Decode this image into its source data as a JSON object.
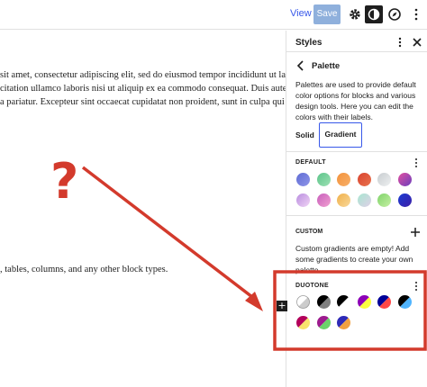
{
  "toolbar": {
    "view_label": "View",
    "save_label": "Save",
    "icons": [
      "gear-icon",
      "styles-icon",
      "compass-icon"
    ]
  },
  "canvas": {
    "para1_lines": [
      "sit amet, consectetur adipiscing elit, sed do eiusmod tempor incididunt ut labore et",
      "citation ullamco laboris nisi ut aliquip ex ea commodo consequat. Duis aute irure dolor",
      "a pariatur. Excepteur sint occaecat cupidatat non proident, sunt in culpa qui officia"
    ],
    "para2": ", tables, columns, and any other block types.",
    "annotation_mark": "?"
  },
  "sidebar": {
    "title": "Styles",
    "palette_title": "Palette",
    "palette_desc": "Palettes are used to provide default color options for blocks and various design tools. Here you can edit the colors with their labels.",
    "tabs": {
      "solid": "Solid",
      "gradient": "Gradient"
    },
    "default_label": "DEFAULT",
    "custom_label": "CUSTOM",
    "custom_desc": "Custom gradients are empty! Add some gradients to create your own palette.",
    "duotone_label": "DUOTONE"
  },
  "gradients": [
    [
      "#5f6cd4",
      "#8f95e8"
    ],
    [
      "#5cc48a",
      "#9de0b4"
    ],
    [
      "#f3923b",
      "#f7b06a"
    ],
    [
      "#d9432e",
      "#e8734f"
    ],
    [
      "#c8cdd0",
      "#eef0f1"
    ],
    [
      "#e24fa0",
      "#6b3fbd"
    ],
    [
      "#b98ee0",
      "#f1d4f4"
    ],
    [
      "#c85fbc",
      "#f1a0d0"
    ],
    [
      "#f0b04a",
      "#f8d89a"
    ],
    [
      "#a8e6d0",
      "#e0d0e8"
    ],
    [
      "#7fd36a",
      "#c6f0a4"
    ],
    [
      "#1a3bd1",
      "#3d1fa8"
    ]
  ],
  "duotones": [
    [
      "#ffffff",
      "#cccccc"
    ],
    [
      "#000000",
      "#7f7f7f"
    ],
    [
      "#000000",
      "#ffffff"
    ],
    [
      "#8c00b7",
      "#fcff41"
    ],
    [
      "#000097",
      "#ff4747"
    ],
    [
      "#000000",
      "#4fb4ff"
    ],
    [
      "#b3005a",
      "#f8e26c"
    ],
    [
      "#9d1b8f",
      "#6bd36a"
    ],
    [
      "#2e2ab6",
      "#f0a040"
    ]
  ],
  "colors": {
    "accent": "#3858e9",
    "annotation": "#d33a2c"
  }
}
